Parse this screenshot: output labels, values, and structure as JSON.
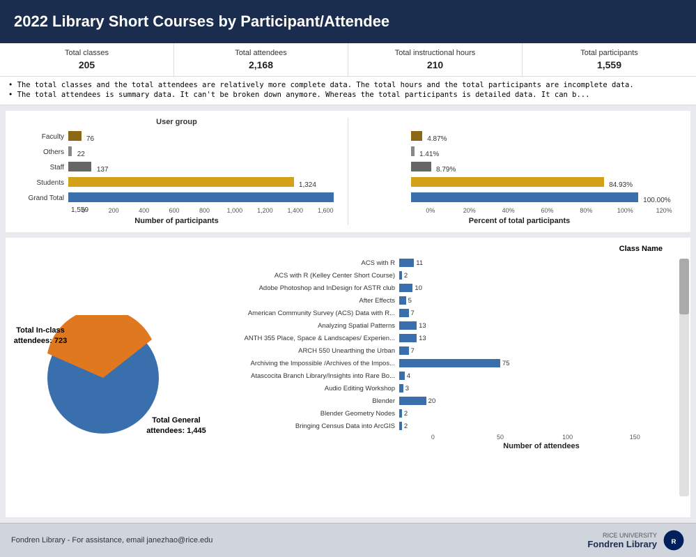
{
  "header": {
    "title": "2022 Library Short Courses by Participant/Attendee"
  },
  "stats": {
    "totalClasses": {
      "label": "Total classes",
      "value": "205"
    },
    "totalAttendees": {
      "label": "Total attendees",
      "value": "2,168"
    },
    "totalHours": {
      "label": "Total instructional hours",
      "value": "210"
    },
    "totalParticipants": {
      "label": "Total participants",
      "value": "1,559"
    }
  },
  "notes": {
    "note1": "•  The total classes and the total attendees are relatively more complete data. The total hours and the total participants are incomplete data.",
    "note2": "•  The total attendees is summary data. It can't be broken down anymore.  Whereas the total participants is detailed data. It can b..."
  },
  "userGroupChart": {
    "title": "User group",
    "rows": [
      {
        "label": "Faculty",
        "value": 76,
        "display": "76",
        "color": "faculty",
        "maxVal": 1600
      },
      {
        "label": "Others",
        "value": 22,
        "display": "22",
        "color": "others",
        "maxVal": 1600
      },
      {
        "label": "Staff",
        "value": 137,
        "display": "137",
        "color": "staff",
        "maxVal": 1600
      },
      {
        "label": "Students",
        "value": 1324,
        "display": "1,324",
        "color": "students",
        "maxVal": 1600
      },
      {
        "label": "Grand Total",
        "value": 1559,
        "display": "1,559",
        "color": "total",
        "maxVal": 1600
      }
    ],
    "xAxisLabels": [
      "0",
      "200",
      "400",
      "600",
      "800",
      "1,000",
      "1,200",
      "1,400",
      "1,600"
    ],
    "xAxisTitle": "Number of participants"
  },
  "percentChart": {
    "rows": [
      {
        "label": "Faculty",
        "value": 4.87,
        "display": "4.87%",
        "color": "faculty",
        "maxVal": 120
      },
      {
        "label": "Others",
        "value": 1.41,
        "display": "1.41%",
        "color": "others",
        "maxVal": 120
      },
      {
        "label": "Staff",
        "value": 8.79,
        "display": "8.79%",
        "color": "staff",
        "maxVal": 120
      },
      {
        "label": "Students",
        "value": 84.93,
        "display": "84.93%",
        "color": "students",
        "maxVal": 120
      },
      {
        "label": "Grand Total",
        "value": 100,
        "display": "100.00%",
        "color": "total",
        "maxVal": 120
      }
    ],
    "xAxisLabels": [
      "0%",
      "20%",
      "40%",
      "60%",
      "80%",
      "100%",
      "120%"
    ],
    "xAxisTitle": "Percent of total participants"
  },
  "pieChart": {
    "inClassLabel": "Total  In-class\nattendees: 723",
    "generalLabel": "Total  General\nattendees: 1,445",
    "inClassValue": 723,
    "generalValue": 1445,
    "inClassPercent": 33,
    "generalPercent": 67
  },
  "classesChart": {
    "title": "Class Name",
    "xAxisLabels": [
      "0",
      "50",
      "100",
      "150"
    ],
    "xAxisTitle": "Number of attendees",
    "maxVal": 150,
    "rows": [
      {
        "label": "ACS with R",
        "value": 11,
        "display": "11"
      },
      {
        "label": "ACS with R (Kelley Center Short Course)",
        "value": 2,
        "display": "2"
      },
      {
        "label": "Adobe Photoshop and InDesign for ASTR club",
        "value": 10,
        "display": "10"
      },
      {
        "label": "After Effects",
        "value": 5,
        "display": "5"
      },
      {
        "label": "American Community Survey (ACS) Data with R...",
        "value": 7,
        "display": "7"
      },
      {
        "label": "Analyzing Spatial Patterns",
        "value": 13,
        "display": "13"
      },
      {
        "label": "ANTH 355 Place, Space & Landscapes/ Experien...",
        "value": 13,
        "display": "13"
      },
      {
        "label": "ARCH 550 Unearthing the Urban",
        "value": 7,
        "display": "7"
      },
      {
        "label": "Archiving the Impossible /Archives of the Impos...",
        "value": 75,
        "display": "75"
      },
      {
        "label": "Atascocita Branch Library/Insights into Rare Bo...",
        "value": 4,
        "display": "4"
      },
      {
        "label": "Audio Editing Workshop",
        "value": 3,
        "display": "3"
      },
      {
        "label": "Blender",
        "value": 20,
        "display": "20"
      },
      {
        "label": "Blender Geometry Nodes",
        "value": 2,
        "display": "2"
      },
      {
        "label": "Bringing Census Data into ArcGIS",
        "value": 2,
        "display": "2"
      }
    ]
  },
  "footer": {
    "text": "Fondren Library - For assistance, email janezhao@rice.edu",
    "university": "RICE UNIVERSITY",
    "library": "Fondren Library"
  }
}
